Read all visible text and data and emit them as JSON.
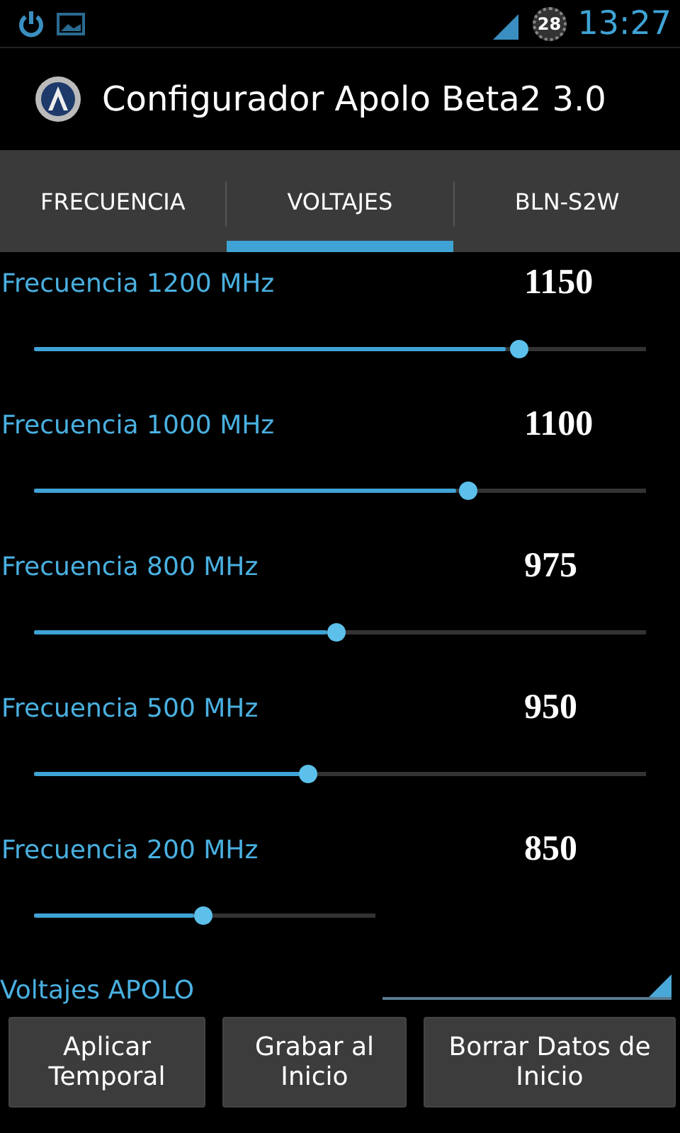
{
  "status_bar": {
    "badge": "28",
    "time": "13:27"
  },
  "title": "Configurador Apolo Beta2 3.0",
  "tabs": [
    {
      "label": "FRECUENCIA",
      "selected": false
    },
    {
      "label": "VOLTAJES",
      "selected": true
    },
    {
      "label": "BLN-S2W",
      "selected": false
    }
  ],
  "sliders": [
    {
      "label": "Frecuencia 1200 MHz",
      "value": "1150",
      "level": 0.77,
      "kind": "wide"
    },
    {
      "label": "Frecuencia 1000 MHz",
      "value": "1100",
      "level": 0.69,
      "kind": "wide"
    },
    {
      "label": "Frecuencia 800 MHz",
      "value": "975",
      "level": 0.48,
      "kind": "wide"
    },
    {
      "label": "Frecuencia 500 MHz",
      "value": "950",
      "level": 0.435,
      "kind": "wide"
    },
    {
      "label": "Frecuencia 200 MHz",
      "value": "850",
      "level": 0.47,
      "kind": "narrow"
    }
  ],
  "section": "Voltajes APOLO",
  "buttons": [
    "Aplicar Temporal",
    "Grabar al Inicio",
    "Borrar Datos de Inicio"
  ]
}
